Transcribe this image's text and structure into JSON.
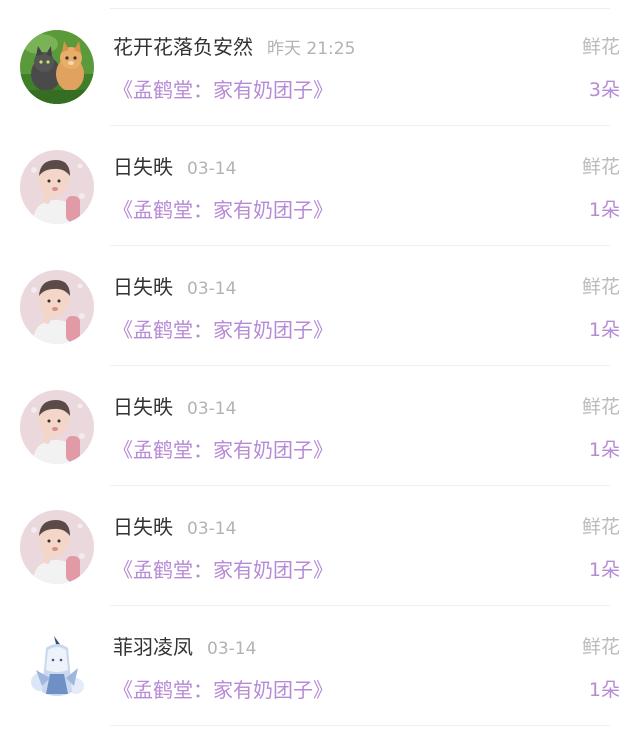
{
  "rewards": [
    {
      "user": "花开花落负安然",
      "time": "昨天 21:25",
      "book": "《孟鹤堂：家有奶团子》",
      "gift_type": "鲜花",
      "count": "3朵",
      "avatar_icon": "kittens-avatar-icon"
    },
    {
      "user": "日失昳",
      "time": "03-14",
      "book": "《孟鹤堂：家有奶团子》",
      "gift_type": "鲜花",
      "count": "1朵",
      "avatar_icon": "child-portrait-avatar-icon"
    },
    {
      "user": "日失昳",
      "time": "03-14",
      "book": "《孟鹤堂：家有奶团子》",
      "gift_type": "鲜花",
      "count": "1朵",
      "avatar_icon": "child-portrait-avatar-icon"
    },
    {
      "user": "日失昳",
      "time": "03-14",
      "book": "《孟鹤堂：家有奶团子》",
      "gift_type": "鲜花",
      "count": "1朵",
      "avatar_icon": "child-portrait-avatar-icon"
    },
    {
      "user": "日失昳",
      "time": "03-14",
      "book": "《孟鹤堂：家有奶团子》",
      "gift_type": "鲜花",
      "count": "1朵",
      "avatar_icon": "child-portrait-avatar-icon"
    },
    {
      "user": "菲羽凌凤",
      "time": "03-14",
      "book": "《孟鹤堂：家有奶团子》",
      "gift_type": "鲜花",
      "count": "1朵",
      "avatar_icon": "anime-character-avatar-icon"
    }
  ],
  "colors": {
    "book_title": "#b68ad6",
    "username": "#333333",
    "timestamp": "#b3b3b3",
    "gift_label": "#bbbbbb"
  }
}
